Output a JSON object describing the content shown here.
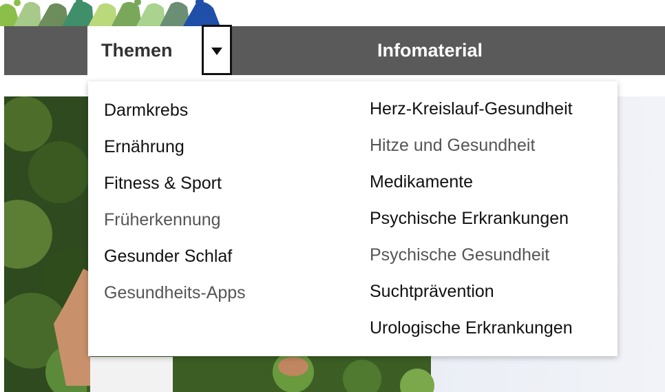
{
  "nav": {
    "themen_label": "Themen",
    "infomaterial_label": "Infomaterial"
  },
  "dropdown": {
    "left_column": [
      {
        "label": "Darmkrebs",
        "muted": false
      },
      {
        "label": "Ernährung",
        "muted": false
      },
      {
        "label": "Fitness & Sport",
        "muted": false
      },
      {
        "label": "Früherkennung",
        "muted": true
      },
      {
        "label": "Gesunder Schlaf",
        "muted": false
      },
      {
        "label": "Gesundheits-Apps",
        "muted": true
      }
    ],
    "right_column": [
      {
        "label": "Herz-Kreislauf-Gesundheit",
        "muted": false
      },
      {
        "label": "Hitze und Gesundheit",
        "muted": true
      },
      {
        "label": "Medikamente",
        "muted": false
      },
      {
        "label": "Psychische Erkrankungen",
        "muted": false
      },
      {
        "label": "Psychische Gesundheit",
        "muted": true
      },
      {
        "label": "Suchtprävention",
        "muted": false
      },
      {
        "label": "Urologische Erkrankungen",
        "muted": false
      }
    ]
  },
  "colors": {
    "navbar": "#5a5a5a",
    "logo_green": "#7cb342",
    "logo_blue": "#1565c0"
  },
  "icons": {
    "caret": "caret-down-icon",
    "logo": "people-figures-logo"
  }
}
